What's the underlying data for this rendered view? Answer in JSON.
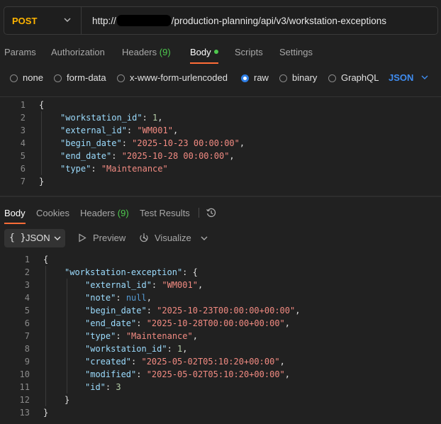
{
  "request": {
    "method": "POST",
    "url_prefix": "http://",
    "url_path": "/production-planning/api/v3/workstation-exceptions"
  },
  "request_tabs": [
    {
      "label": "Params"
    },
    {
      "label": "Authorization"
    },
    {
      "label": "Headers",
      "count": "(9)"
    },
    {
      "label": "Body"
    },
    {
      "label": "Scripts"
    },
    {
      "label": "Settings"
    }
  ],
  "body_types": [
    "none",
    "form-data",
    "x-www-form-urlencoded",
    "raw",
    "binary",
    "GraphQL"
  ],
  "body_selected": "raw",
  "body_language": "JSON",
  "request_code": {
    "line_numbers": [
      "1",
      "2",
      "3",
      "4",
      "5",
      "6",
      "7"
    ],
    "open": "{",
    "close": "}",
    "fields": [
      {
        "key": "\"workstation_id\"",
        "value": "1",
        "kind": "n"
      },
      {
        "key": "\"external_id\"",
        "value": "\"WM001\"",
        "kind": "s"
      },
      {
        "key": "\"begin_date\"",
        "value": "\"2025-10-23 00:00:00\"",
        "kind": "s"
      },
      {
        "key": "\"end_date\"",
        "value": "\"2025-10-28 00:00:00\"",
        "kind": "s"
      },
      {
        "key": "\"type\"",
        "value": "\"Maintenance\"",
        "kind": "s"
      }
    ]
  },
  "response_tabs": [
    {
      "label": "Body"
    },
    {
      "label": "Cookies"
    },
    {
      "label": "Headers",
      "count": "(9)"
    },
    {
      "label": "Test Results"
    }
  ],
  "response_format": {
    "braces": "{ }",
    "label": "JSON"
  },
  "response_actions": {
    "preview": "Preview",
    "visualize": "Visualize"
  },
  "response_code": {
    "line_numbers": [
      "1",
      "2",
      "3",
      "4",
      "5",
      "6",
      "7",
      "8",
      "9",
      "10",
      "11",
      "12",
      "13"
    ],
    "open": "{",
    "close": "}",
    "object_key": "\"workstation-exception\"",
    "object_open": "{",
    "object_close": "}",
    "fields": [
      {
        "key": "\"external_id\"",
        "value": "\"WM001\"",
        "kind": "s"
      },
      {
        "key": "\"note\"",
        "value": "null",
        "kind": "nl"
      },
      {
        "key": "\"begin_date\"",
        "value": "\"2025-10-23T00:00:00+00:00\"",
        "kind": "s"
      },
      {
        "key": "\"end_date\"",
        "value": "\"2025-10-28T00:00:00+00:00\"",
        "kind": "s"
      },
      {
        "key": "\"type\"",
        "value": "\"Maintenance\"",
        "kind": "s"
      },
      {
        "key": "\"workstation_id\"",
        "value": "1",
        "kind": "n"
      },
      {
        "key": "\"created\"",
        "value": "\"2025-05-02T05:10:20+00:00\"",
        "kind": "s"
      },
      {
        "key": "\"modified\"",
        "value": "\"2025-05-02T05:10:20+00:00\"",
        "kind": "s"
      },
      {
        "key": "\"id\"",
        "value": "3",
        "kind": "n"
      }
    ]
  },
  "colors": {
    "method": "#ffb400",
    "accent_tab": "#ff6c37",
    "count_green": "#4ec94e",
    "radio_selected": "#2f7fe6",
    "json_key": "#9cdcfe",
    "json_string": "#f28b82"
  },
  "icons": [
    "chevron-down-icon",
    "history-icon",
    "preview-play-icon",
    "visualize-icon"
  ]
}
